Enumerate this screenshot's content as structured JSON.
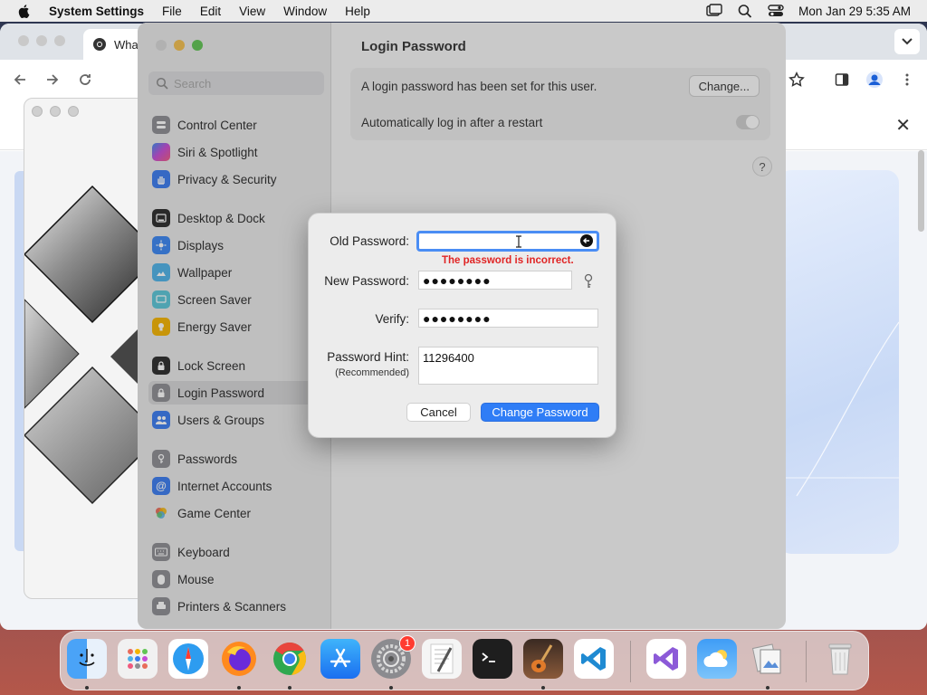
{
  "menubar": {
    "app_name": "System Settings",
    "items": [
      "File",
      "Edit",
      "View",
      "Window",
      "Help"
    ],
    "clock": "Mon Jan 29  5:35 AM"
  },
  "chrome": {
    "tab_title": "What"
  },
  "settings": {
    "search_placeholder": "Search",
    "sidebar": [
      {
        "label": "Control Center",
        "icon": "control-center-icon",
        "color": "#8e8e93"
      },
      {
        "label": "Siri & Spotlight",
        "icon": "siri-icon",
        "color": "#c84bd6"
      },
      {
        "label": "Privacy & Security",
        "icon": "hand-icon",
        "color": "#3a7cf0"
      },
      {
        "label": "Desktop & Dock",
        "icon": "dock-icon",
        "color": "#2b2b2b"
      },
      {
        "label": "Displays",
        "icon": "sun-icon",
        "color": "#3a86f2"
      },
      {
        "label": "Wallpaper",
        "icon": "wallpaper-icon",
        "color": "#4fb2e8"
      },
      {
        "label": "Screen Saver",
        "icon": "screensaver-icon",
        "color": "#5ac6d8"
      },
      {
        "label": "Energy Saver",
        "icon": "lightbulb-icon",
        "color": "#f5b400"
      },
      {
        "label": "Lock Screen",
        "icon": "lock-icon",
        "color": "#2b2b2b"
      },
      {
        "label": "Login Password",
        "icon": "login-password-icon",
        "color": "#8e8e93"
      },
      {
        "label": "Users & Groups",
        "icon": "users-icon",
        "color": "#3a7cf0"
      },
      {
        "label": "Passwords",
        "icon": "key-icon",
        "color": "#8e8e93"
      },
      {
        "label": "Internet Accounts",
        "icon": "at-icon",
        "color": "#3a7cf0"
      },
      {
        "label": "Game Center",
        "icon": "game-center-icon",
        "color": "#e86c5a"
      },
      {
        "label": "Keyboard",
        "icon": "keyboard-icon",
        "color": "#8e8e93"
      },
      {
        "label": "Mouse",
        "icon": "mouse-icon",
        "color": "#8e8e93"
      },
      {
        "label": "Printers & Scanners",
        "icon": "printer-icon",
        "color": "#8e8e93"
      }
    ],
    "pane_title": "Login Password",
    "password_set_text": "A login password has been set for this user.",
    "change_button": "Change...",
    "auto_login_text": "Automatically log in after a restart",
    "help": "?"
  },
  "dialog": {
    "old_label": "Old Password:",
    "old_value": "",
    "error": "The password is incorrect.",
    "new_label": "New Password:",
    "new_value": "●●●●●●●●",
    "verify_label": "Verify:",
    "verify_value": "●●●●●●●●",
    "hint_label": "Password Hint:",
    "hint_sub": "(Recommended)",
    "hint_value": "11296400",
    "cancel": "Cancel",
    "confirm": "Change Password"
  },
  "dock": {
    "apps": [
      "finder-icon",
      "launchpad-icon",
      "safari-icon",
      "firefox-icon",
      "chrome-icon",
      "app-store-icon",
      "system-settings-icon",
      "textedit-icon",
      "terminal-icon",
      "garageband-icon",
      "vscode-icon",
      "visual-studio-icon",
      "weather-icon",
      "preview-icon",
      "trash-icon"
    ],
    "settings_badge": "1"
  },
  "colors": {
    "accent": "#2f7df6",
    "error": "#e02424"
  }
}
